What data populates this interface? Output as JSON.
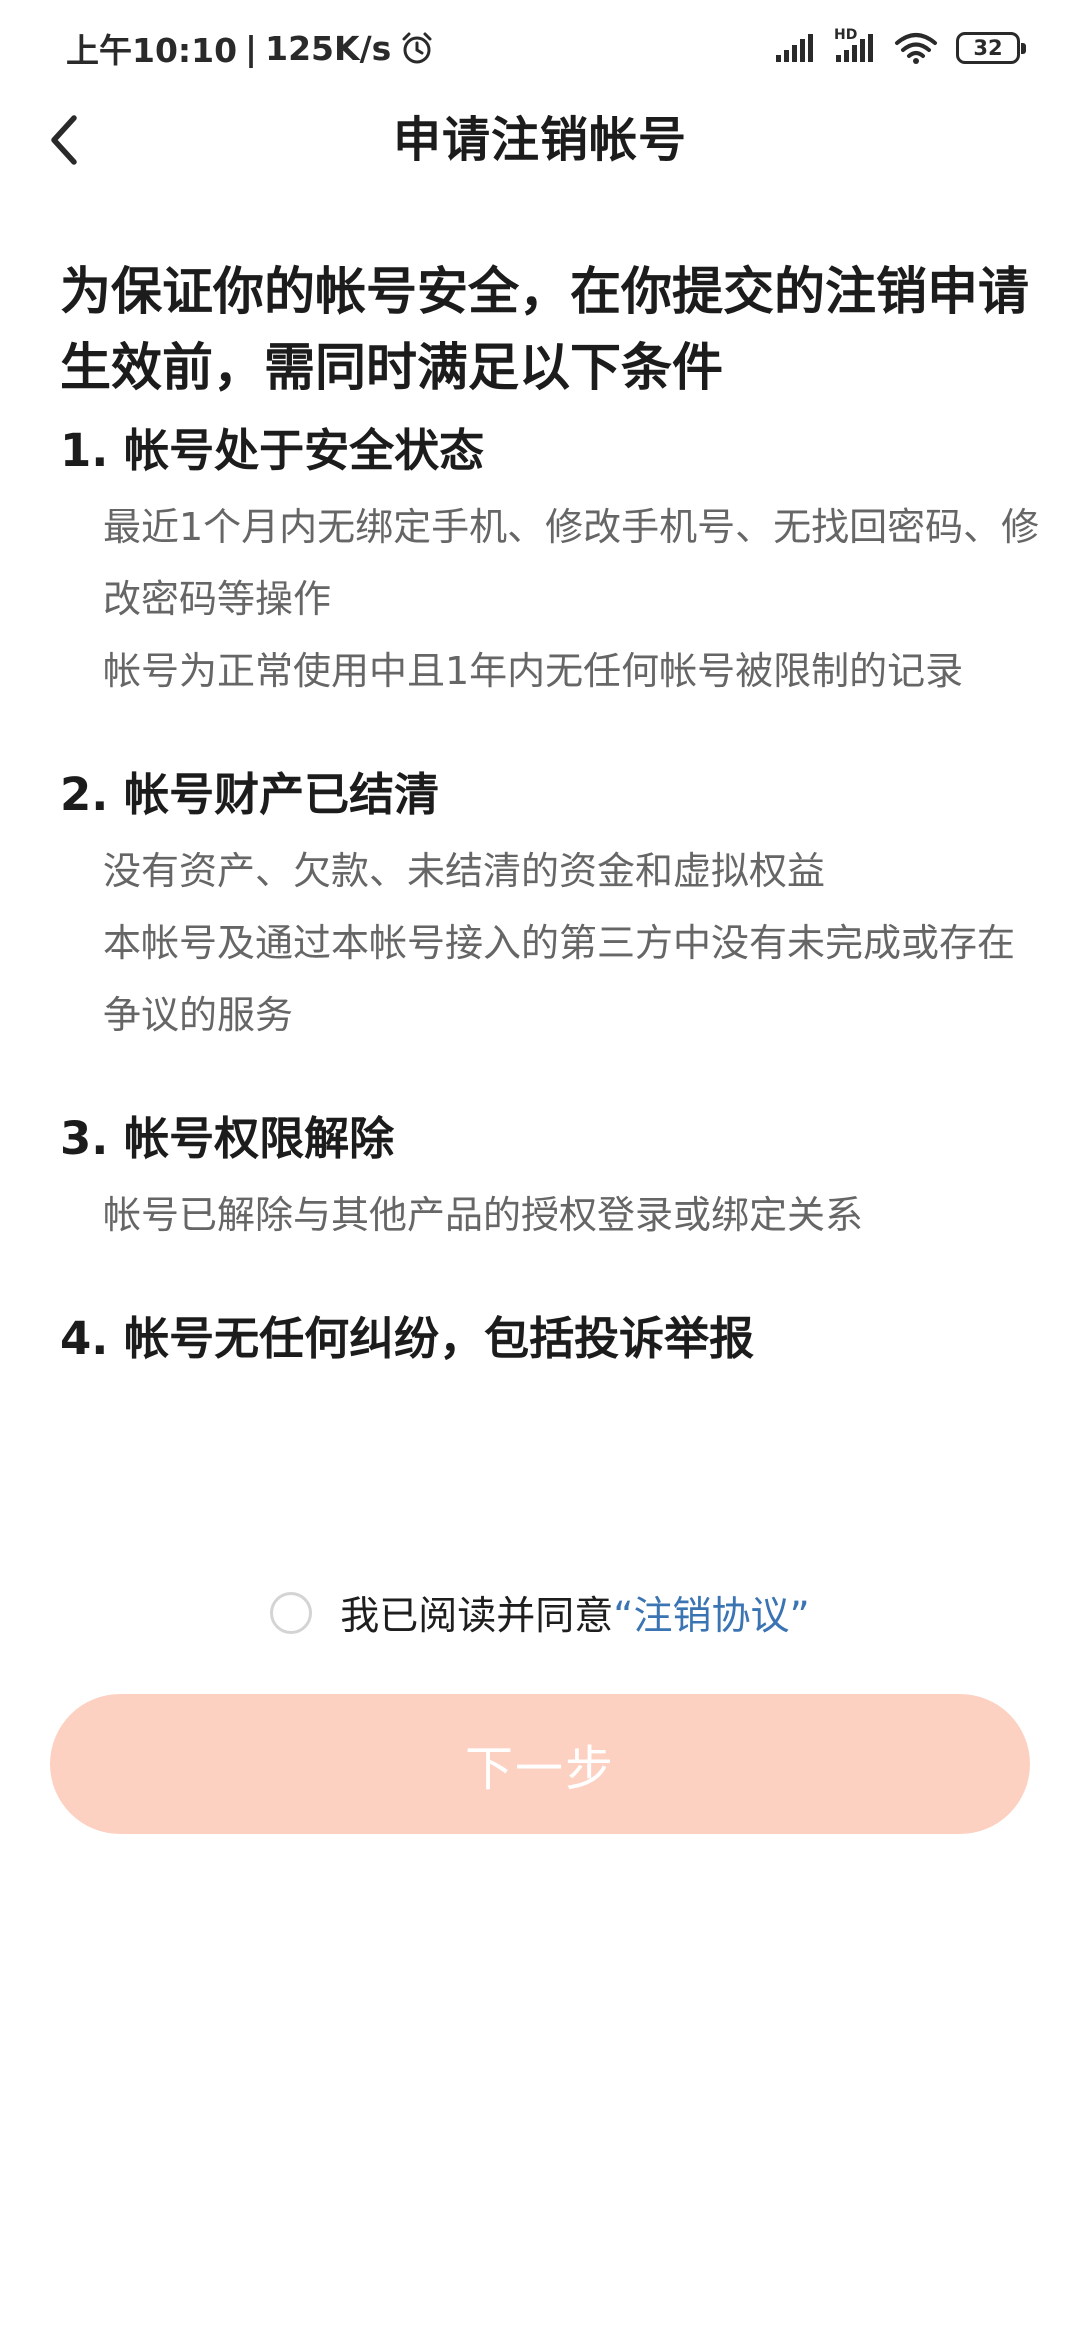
{
  "status_bar": {
    "time": "上午10:10",
    "separator": "|",
    "speed": "125K/s",
    "hd_label": "HD",
    "battery": "32",
    "icons": [
      "alarm-icon",
      "signal-icon",
      "hd-signal-icon",
      "wifi-icon",
      "battery-icon"
    ]
  },
  "header": {
    "title": "申请注销帐号",
    "back_icon": "back-chevron-icon"
  },
  "main": {
    "headline": "为保证你的帐号安全，在你提交的注销申请生效前，需同时满足以下条件",
    "sections": [
      {
        "title": "1. 帐号处于安全状态",
        "items": [
          "最近1个月内无绑定手机、修改手机号、无找回密码、修改密码等操作",
          "帐号为正常使用中且1年内无任何帐号被限制的记录"
        ]
      },
      {
        "title": "2. 帐号财产已结清",
        "items": [
          "没有资产、欠款、未结清的资金和虚拟权益",
          "本帐号及通过本帐号接入的第三方中没有未完成或存在争议的服务"
        ]
      },
      {
        "title": "3. 帐号权限解除",
        "items": [
          "帐号已解除与其他产品的授权登录或绑定关系"
        ]
      },
      {
        "title": "4. 帐号无任何纠纷，包括投诉举报",
        "items": []
      }
    ]
  },
  "agreement": {
    "text": "我已阅读并同意",
    "link": "“注销协议”",
    "checked": false
  },
  "next_button": {
    "label": "下一步"
  },
  "colors": {
    "button_bg": "#fdd1c1",
    "link": "#3a74b3",
    "secondary_text": "#666666"
  }
}
